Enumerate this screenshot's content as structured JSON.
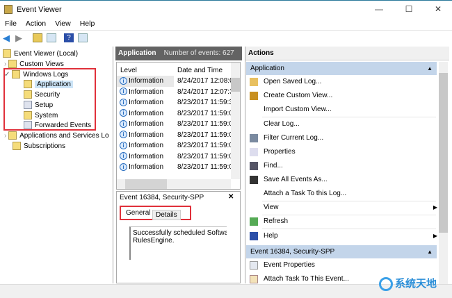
{
  "window": {
    "title": "Event Viewer",
    "minimize": "—",
    "maximize": "☐",
    "close": "✕"
  },
  "menu": [
    "File",
    "Action",
    "View",
    "Help"
  ],
  "tree": {
    "root": "Event Viewer (Local)",
    "custom_views": "Custom Views",
    "windows_logs": "Windows Logs",
    "logs": [
      "Application",
      "Security",
      "Setup",
      "System",
      "Forwarded Events"
    ],
    "apps_services": "Applications and Services Lo",
    "subscriptions": "Subscriptions"
  },
  "events": {
    "title": "Application",
    "count_label": "Number of events: 627",
    "columns": [
      "Level",
      "Date and Time"
    ],
    "rows": [
      [
        "Information",
        "8/24/2017 12:08:0"
      ],
      [
        "Information",
        "8/24/2017 12:07:3"
      ],
      [
        "Information",
        "8/23/2017 11:59:3"
      ],
      [
        "Information",
        "8/23/2017 11:59:0"
      ],
      [
        "Information",
        "8/23/2017 11:59:0"
      ],
      [
        "Information",
        "8/23/2017 11:59:0"
      ],
      [
        "Information",
        "8/23/2017 11:59:0"
      ],
      [
        "Information",
        "8/23/2017 11:59:0"
      ],
      [
        "Information",
        "8/23/2017 11:59:0"
      ]
    ]
  },
  "detail": {
    "title": "Event 16384, Security-SPP",
    "close": "✕",
    "tabs": [
      "General",
      "Details"
    ],
    "text1": "Successfully scheduled Softwar",
    "text2": "RulesEngine."
  },
  "actions": {
    "title": "Actions",
    "section1": "Application",
    "items": [
      "Open Saved Log...",
      "Create Custom View...",
      "Import Custom View...",
      "Clear Log...",
      "Filter Current Log...",
      "Properties",
      "Find...",
      "Save All Events As...",
      "Attach a Task To this Log...",
      "View",
      "Refresh",
      "Help"
    ],
    "section2": "Event 16384, Security-SPP",
    "items2": [
      "Event Properties",
      "Attach Task To This Event..."
    ]
  },
  "watermark": "系统天地"
}
